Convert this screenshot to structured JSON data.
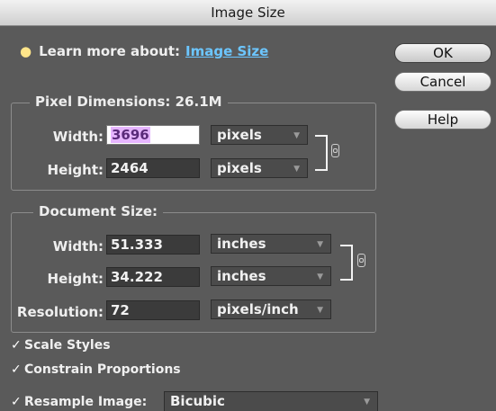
{
  "window": {
    "title": "Image Size"
  },
  "learn": {
    "prefix": "Learn more about:",
    "link": "Image Size"
  },
  "buttons": {
    "ok": "OK",
    "cancel": "Cancel",
    "help": "Help"
  },
  "pixel_dimensions": {
    "legend": "Pixel Dimensions:  26.1M",
    "width_label": "Width:",
    "width_value": "3696",
    "width_unit": "pixels",
    "height_label": "Height:",
    "height_value": "2464",
    "height_unit": "pixels"
  },
  "document_size": {
    "legend": "Document Size:",
    "width_label": "Width:",
    "width_value": "51.333",
    "width_unit": "inches",
    "height_label": "Height:",
    "height_value": "34.222",
    "height_unit": "inches",
    "resolution_label": "Resolution:",
    "resolution_value": "72",
    "resolution_unit": "pixels/inch"
  },
  "options": {
    "scale_styles": "Scale Styles",
    "constrain": "Constrain Proportions",
    "resample": "Resample Image:",
    "resample_method": "Bicubic"
  }
}
